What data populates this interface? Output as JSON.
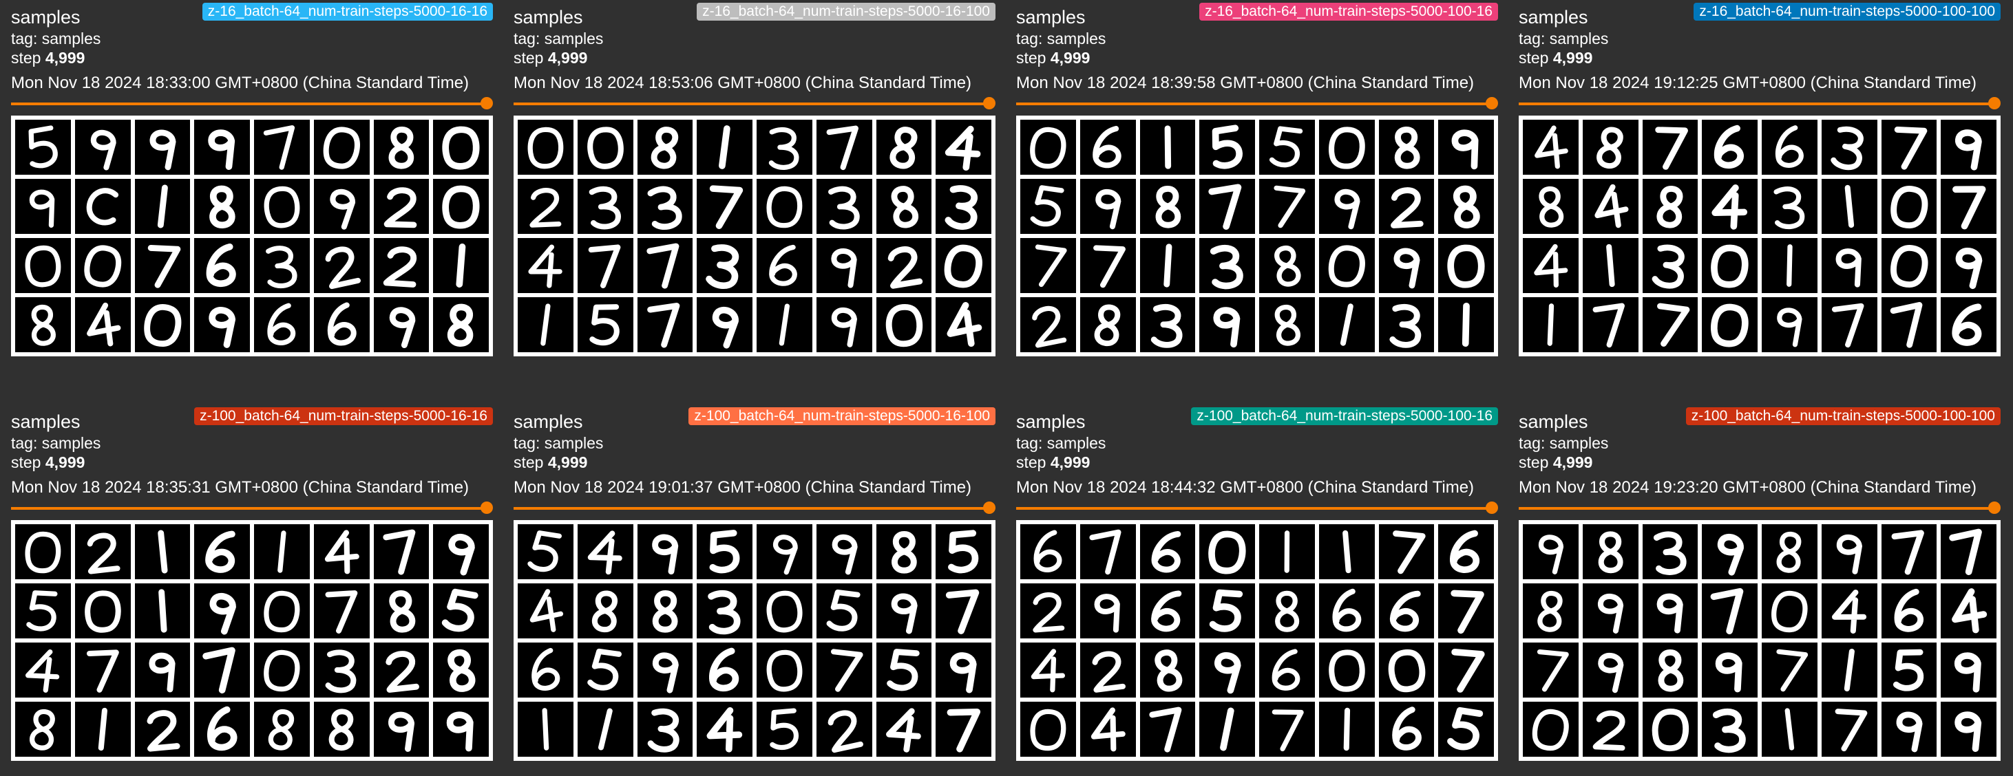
{
  "cards": [
    {
      "title": "samples",
      "run": "z-16_batch-64_num-train-steps-5000-16-16",
      "run_color": "#29b6f6",
      "tag_line": "tag: samples",
      "step_label": "step",
      "step_value": "4,999",
      "timestamp": "Mon Nov 18 2024 18:33:00 GMT+0800 (China Standard Time)",
      "step_slider_fraction": 1.0,
      "digits": [
        "5",
        "9",
        "9",
        "9",
        "7",
        "0",
        "8",
        "0",
        "9",
        "C",
        "1",
        "8",
        "0",
        "9",
        "2",
        "0",
        "0",
        "0",
        "7",
        "6",
        "3",
        "2",
        "2",
        "1",
        "8",
        "4",
        "0",
        "9",
        "6",
        "6",
        "9",
        "8"
      ]
    },
    {
      "title": "samples",
      "run": "z-16_batch-64_num-train-steps-5000-16-100",
      "run_color": "#bdbdbd",
      "tag_line": "tag: samples",
      "step_label": "step",
      "step_value": "4,999",
      "timestamp": "Mon Nov 18 2024 18:53:06 GMT+0800 (China Standard Time)",
      "step_slider_fraction": 1.0,
      "digits": [
        "0",
        "0",
        "8",
        "1",
        "3",
        "7",
        "8",
        "4",
        "2",
        "3",
        "3",
        "7",
        "0",
        "3",
        "8",
        "3",
        "4",
        "7",
        "7",
        "3",
        "6",
        "9",
        "2",
        "0",
        "1",
        "5",
        "7",
        "9",
        "1",
        "9",
        "0",
        "4"
      ]
    },
    {
      "title": "samples",
      "run": "z-16_batch-64_num-train-steps-5000-100-16",
      "run_color": "#ec407a",
      "tag_line": "tag: samples",
      "step_label": "step",
      "step_value": "4,999",
      "timestamp": "Mon Nov 18 2024 18:39:58 GMT+0800 (China Standard Time)",
      "step_slider_fraction": 1.0,
      "digits": [
        "0",
        "6",
        "1",
        "5",
        "5",
        "0",
        "8",
        "9",
        "5",
        "9",
        "8",
        "7",
        "7",
        "9",
        "2",
        "8",
        "7",
        "7",
        "1",
        "3",
        "8",
        "0",
        "9",
        "0",
        "2",
        "8",
        "3",
        "9",
        "8",
        "1",
        "3",
        "1"
      ]
    },
    {
      "title": "samples",
      "run": "z-16_batch-64_num-train-steps-5000-100-100",
      "run_color": "#0077bb",
      "tag_line": "tag: samples",
      "step_label": "step",
      "step_value": "4,999",
      "timestamp": "Mon Nov 18 2024 19:12:25 GMT+0800 (China Standard Time)",
      "step_slider_fraction": 1.0,
      "digits": [
        "4",
        "8",
        "7",
        "6",
        "6",
        "3",
        "7",
        "9",
        "8",
        "4",
        "8",
        "4",
        "3",
        "1",
        "0",
        "7",
        "4",
        "1",
        "3",
        "0",
        "1",
        "9",
        "0",
        "9",
        "1",
        "7",
        "7",
        "0",
        "9",
        "7",
        "7",
        "6"
      ]
    },
    {
      "title": "samples",
      "run": "z-100_batch-64_num-train-steps-5000-16-16",
      "run_color": "#cc3311",
      "tag_line": "tag: samples",
      "step_label": "step",
      "step_value": "4,999",
      "timestamp": "Mon Nov 18 2024 18:35:31 GMT+0800 (China Standard Time)",
      "step_slider_fraction": 1.0,
      "digits": [
        "0",
        "2",
        "1",
        "6",
        "1",
        "4",
        "7",
        "9",
        "5",
        "0",
        "1",
        "9",
        "0",
        "7",
        "8",
        "5",
        "4",
        "7",
        "9",
        "7",
        "0",
        "3",
        "2",
        "8",
        "8",
        "1",
        "2",
        "6",
        "8",
        "8",
        "9",
        "9"
      ]
    },
    {
      "title": "samples",
      "run": "z-100_batch-64_num-train-steps-5000-16-100",
      "run_color": "#ff7043",
      "tag_line": "tag: samples",
      "step_label": "step",
      "step_value": "4,999",
      "timestamp": "Mon Nov 18 2024 19:01:37 GMT+0800 (China Standard Time)",
      "step_slider_fraction": 1.0,
      "digits": [
        "5",
        "4",
        "9",
        "5",
        "9",
        "9",
        "8",
        "5",
        "4",
        "8",
        "8",
        "3",
        "0",
        "5",
        "9",
        "7",
        "6",
        "5",
        "9",
        "6",
        "0",
        "7",
        "5",
        "9",
        "1",
        "1",
        "3",
        "4",
        "5",
        "2",
        "4",
        "7"
      ]
    },
    {
      "title": "samples",
      "run": "z-100_batch-64_num-train-steps-5000-100-16",
      "run_color": "#009988",
      "tag_line": "tag: samples",
      "step_label": "step",
      "step_value": "4,999",
      "timestamp": "Mon Nov 18 2024 18:44:32 GMT+0800 (China Standard Time)",
      "step_slider_fraction": 1.0,
      "digits": [
        "6",
        "7",
        "6",
        "0",
        "1",
        "1",
        "7",
        "6",
        "2",
        "9",
        "6",
        "5",
        "8",
        "6",
        "6",
        "7",
        "4",
        "2",
        "8",
        "9",
        "6",
        "0",
        "0",
        "7",
        "0",
        "4",
        "7",
        "1",
        "7",
        "1",
        "6",
        "5"
      ]
    },
    {
      "title": "samples",
      "run": "z-100_batch-64_num-train-steps-5000-100-100",
      "run_color": "#cc3311",
      "tag_line": "tag: samples",
      "step_label": "step",
      "step_value": "4,999",
      "timestamp": "Mon Nov 18 2024 19:23:20 GMT+0800 (China Standard Time)",
      "step_slider_fraction": 1.0,
      "digits": [
        "9",
        "8",
        "3",
        "9",
        "8",
        "9",
        "7",
        "7",
        "8",
        "9",
        "9",
        "7",
        "0",
        "4",
        "6",
        "4",
        "7",
        "9",
        "8",
        "9",
        "7",
        "1",
        "5",
        "9",
        "0",
        "2",
        "0",
        "3",
        "1",
        "7",
        "9",
        "9"
      ]
    }
  ]
}
